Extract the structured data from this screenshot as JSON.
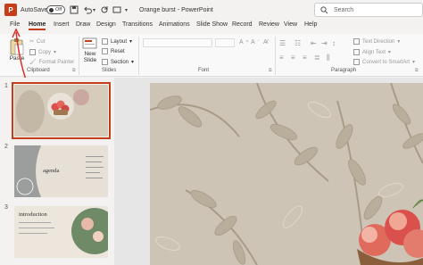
{
  "titlebar": {
    "app_icon_letter": "P",
    "autosave_label": "AutoSave",
    "autosave_state": "Off",
    "doc_title": "Orange burst  -  PowerPoint",
    "search_placeholder": "Search"
  },
  "tabs": [
    "File",
    "Home",
    "Insert",
    "Draw",
    "Design",
    "Transitions",
    "Animations",
    "Slide Show",
    "Record",
    "Review",
    "View",
    "Help"
  ],
  "active_tab": "Home",
  "ribbon": {
    "clipboard": {
      "paste_label": "Paste",
      "cut_label": "Cut",
      "copy_label": "Copy",
      "format_painter_label": "Format Painter",
      "group_label": "Clipboard"
    },
    "slides": {
      "new_slide_label": "New",
      "new_slide_label2": "Slide",
      "layout_label": "Layout",
      "reset_label": "Reset",
      "section_label": "Section",
      "group_label": "Slides"
    },
    "font": {
      "group_label": "Font"
    },
    "paragraph": {
      "text_direction_label": "Text Direction",
      "align_text_label": "Align Text",
      "smartart_label": "Convert to SmartArt",
      "group_label": "Paragraph"
    }
  },
  "thumbnails": [
    {
      "number": "1",
      "title": ""
    },
    {
      "number": "2",
      "title": "agenda"
    },
    {
      "number": "3",
      "title": "introduction"
    }
  ],
  "colors": {
    "accent": "#c43e1c",
    "slide_bg": "#cdc4b5",
    "leaf": "#b6aa98"
  }
}
